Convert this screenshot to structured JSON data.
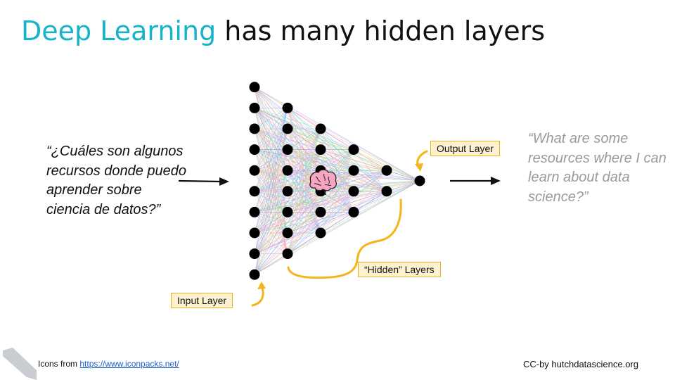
{
  "title": {
    "accent": "Deep Learning",
    "rest": " has many hidden layers"
  },
  "input_quote": "“¿Cuáles son algunos recursos donde puedo aprender sobre ciencia de datos?”",
  "output_quote": "“What are some resources where I can learn about data science?”",
  "labels": {
    "input_layer": "Input Layer",
    "hidden_layers": "“Hidden” Layers",
    "output_layer": "Output Layer"
  },
  "network": {
    "layer_sizes": [
      10,
      8,
      6,
      4,
      2,
      1
    ]
  },
  "footer": {
    "icons_prefix": "Icons from ",
    "icons_link": "https://www.iconpacks.net/",
    "credit": "CC-by hutchdatascience.org"
  },
  "colors": {
    "accent": "#17b3c8",
    "label_fill": "#fdf1cf",
    "arrow": "#f3b51b",
    "node": "#000000"
  },
  "icons": [
    "brain-icon",
    "corner-logo-icon"
  ]
}
